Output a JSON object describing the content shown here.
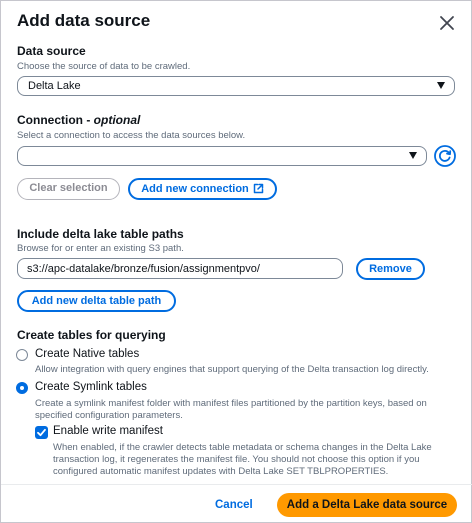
{
  "dialog": {
    "title": "Add data source"
  },
  "data_source": {
    "label": "Data source",
    "description": "Choose the source of data to be crawled.",
    "selected": "Delta Lake"
  },
  "connection": {
    "label": "Connection - ",
    "optional": "optional",
    "description": "Select a connection to access the data sources below.",
    "selected": "",
    "clear_label": "Clear selection",
    "add_label": "Add new connection"
  },
  "paths": {
    "label": "Include delta lake table paths",
    "description": "Browse for or enter an existing S3 path.",
    "value": "s3://apc-datalake/bronze/fusion/assignmentpvo/",
    "remove_label": "Remove",
    "add_label": "Add new delta table path"
  },
  "tables": {
    "label": "Create tables for querying",
    "native": {
      "label": "Create Native tables",
      "description": "Allow integration with query engines that support querying of the Delta transaction log directly.",
      "selected": false
    },
    "symlink": {
      "label": "Create Symlink tables",
      "description": "Create a symlink manifest folder with manifest files partitioned by the partition keys, based on specified configuration parameters.",
      "selected": true
    },
    "write_manifest": {
      "label": "Enable write manifest",
      "description": "When enabled, if the crawler detects table metadata or schema changes in the Delta Lake transaction log, it regenerates the manifest file. You should not choose this option if you configured automatic manifest updates with Delta Lake SET TBLPROPERTIES.",
      "checked": true
    }
  },
  "footer": {
    "cancel_label": "Cancel",
    "submit_label": "Add a Delta Lake data source"
  },
  "colors": {
    "primary_blue": "#006ce0",
    "primary_orange": "#ff9900"
  }
}
